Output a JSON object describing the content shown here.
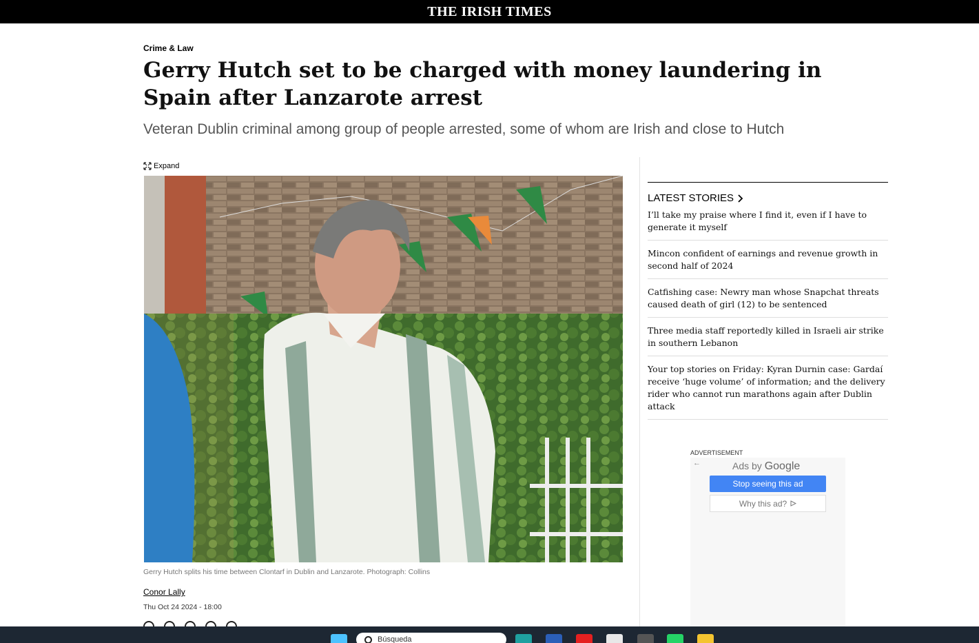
{
  "masthead": "THE IRISH TIMES",
  "article": {
    "section": "Crime & Law",
    "headline": "Gerry Hutch set to be charged with money laundering in Spain after Lanzarote arrest",
    "standfirst": "Veteran Dublin criminal among group of people arrested, some of whom are Irish and close to Hutch",
    "expand_label": "Expand",
    "caption": "Gerry Hutch splits his time between Clontarf in Dublin and Lanzarote. Photograph: Collins",
    "author": "Conor Lally",
    "date": "Thu Oct 24 2024 - 18:00"
  },
  "sidebar": {
    "latest_heading": "LATEST STORIES",
    "stories": [
      "I’ll take my praise where I find it, even if I have to generate it myself",
      "Mincon confident of earnings and revenue growth in second half of 2024",
      "Catfishing case: Newry man whose Snapchat threats caused death of girl (12) to be sentenced",
      "Three media staff reportedly killed in Israeli air strike in southern Lebanon",
      "Your top stories on Friday: Kyran Durnin case: Gardaí receive ‘huge volume’ of information; and the delivery rider who cannot run marathons again after Dublin attack"
    ]
  },
  "ad": {
    "label": "ADVERTISEMENT",
    "ads_by": "Ads by",
    "google": "Google",
    "stop_label": "Stop seeing this ad",
    "why_label": "Why this ad?"
  },
  "taskbar": {
    "search_placeholder": "Búsqueda"
  },
  "colors": {
    "topbar": "#000000",
    "ad_button": "#4285f4",
    "taskbar": "#1d2733"
  }
}
